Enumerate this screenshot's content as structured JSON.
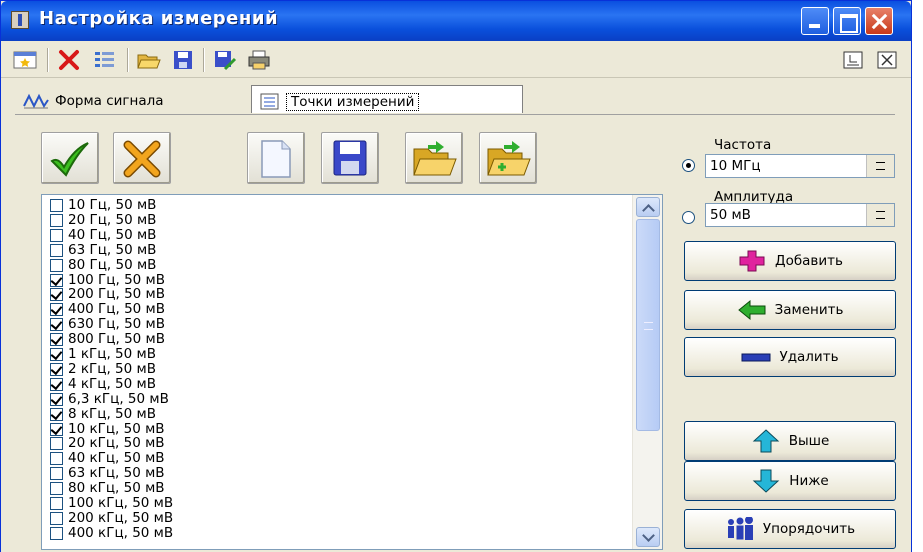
{
  "window": {
    "title": "Настройка измерений"
  },
  "tabs": [
    {
      "label": "Форма сигнала",
      "active": false
    },
    {
      "label": "Точки измерений",
      "active": true
    }
  ],
  "frequency": {
    "label": "Частота",
    "value": "10 МГц",
    "selected": true
  },
  "amplitude": {
    "label": "Амплитуда",
    "value": "50 мВ",
    "selected": false
  },
  "actions": {
    "add": "Добавить",
    "replace": "Заменить",
    "delete": "Удалить",
    "up": "Выше",
    "down": "Ниже",
    "sort": "Упорядочить"
  },
  "points": [
    {
      "label": "10 Гц, 50 мВ",
      "checked": false
    },
    {
      "label": "20 Гц, 50 мВ",
      "checked": false
    },
    {
      "label": "40 Гц, 50 мВ",
      "checked": false
    },
    {
      "label": "63 Гц, 50 мВ",
      "checked": false
    },
    {
      "label": "80 Гц, 50 мВ",
      "checked": false
    },
    {
      "label": "100 Гц, 50 мВ",
      "checked": true
    },
    {
      "label": "200 Гц, 50 мВ",
      "checked": true
    },
    {
      "label": "400 Гц, 50 мВ",
      "checked": true
    },
    {
      "label": "630 Гц, 50 мВ",
      "checked": true
    },
    {
      "label": "800 Гц, 50 мВ",
      "checked": true
    },
    {
      "label": "1 кГц, 50 мВ",
      "checked": true
    },
    {
      "label": "2 кГц, 50 мВ",
      "checked": true
    },
    {
      "label": "4 кГц, 50 мВ",
      "checked": true
    },
    {
      "label": "6,3 кГц, 50 мВ",
      "checked": true
    },
    {
      "label": "8 кГц, 50 мВ",
      "checked": true
    },
    {
      "label": "10 кГц, 50 мВ",
      "checked": true
    },
    {
      "label": "20 кГц, 50 мВ",
      "checked": false
    },
    {
      "label": "40 кГц, 50 мВ",
      "checked": false
    },
    {
      "label": "63 кГц, 50 мВ",
      "checked": false
    },
    {
      "label": "80 кГц, 50 мВ",
      "checked": false
    },
    {
      "label": "100 кГц, 50 мВ",
      "checked": false
    },
    {
      "label": "200 кГц, 50 мВ",
      "checked": false
    },
    {
      "label": "400 кГц, 50 мВ",
      "checked": false
    }
  ],
  "icons": {
    "toolbar": [
      "window-icon",
      "delete-icon",
      "list-settings-icon",
      "open-folder-icon",
      "save-icon",
      "save-as-icon",
      "print-icon"
    ],
    "big_buttons": [
      "check-icon",
      "cancel-icon",
      "new-file-icon",
      "save-icon",
      "open-folder-icon",
      "add-folder-icon"
    ]
  }
}
